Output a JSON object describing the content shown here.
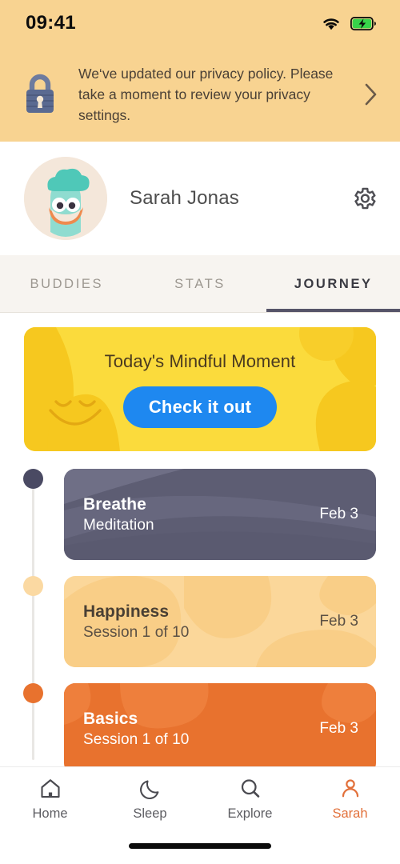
{
  "status_bar": {
    "time": "09:41",
    "wifi_icon": "wifi-icon",
    "battery_icon": "battery-charging-icon"
  },
  "banner": {
    "icon": "lock-icon",
    "message": "We‘ve updated our privacy policy. Please take a moment to review your privacy settings.",
    "chevron_icon": "chevron-right-icon",
    "background_color": "#F8D391"
  },
  "profile": {
    "avatar_icon": "avatar-character",
    "name": "Sarah Jonas",
    "settings_icon": "gear-icon"
  },
  "tabs": [
    {
      "label": "Buddies",
      "active": false
    },
    {
      "label": "Stats",
      "active": false
    },
    {
      "label": "Journey",
      "active": true
    }
  ],
  "mindful_card": {
    "title": "Today's Mindful Moment",
    "button_label": "Check it out",
    "background_color": "#FBDB3C",
    "button_color": "#1E88F0"
  },
  "journey": [
    {
      "title": "Breathe",
      "subtitle": "Meditation",
      "date": "Feb 3",
      "card_color": "#5D5D73",
      "dot_color": "#4A4A63",
      "text_theme": "light"
    },
    {
      "title": "Happiness",
      "subtitle": "Session 1 of 10",
      "date": "Feb 3",
      "card_color": "#FBD79A",
      "dot_color": "#FBD9A2",
      "text_theme": "dark"
    },
    {
      "title": "Basics",
      "subtitle": "Session 1 of 10",
      "date": "Feb 3",
      "card_color": "#E8722E",
      "dot_color": "#E8722E",
      "text_theme": "light"
    }
  ],
  "bottom_nav": {
    "active_color": "#E2703A",
    "items": [
      {
        "label": "Home",
        "icon": "home-icon",
        "active": false
      },
      {
        "label": "Sleep",
        "icon": "moon-icon",
        "active": false
      },
      {
        "label": "Explore",
        "icon": "search-icon",
        "active": false
      },
      {
        "label": "Sarah",
        "icon": "person-icon",
        "active": true
      }
    ]
  }
}
